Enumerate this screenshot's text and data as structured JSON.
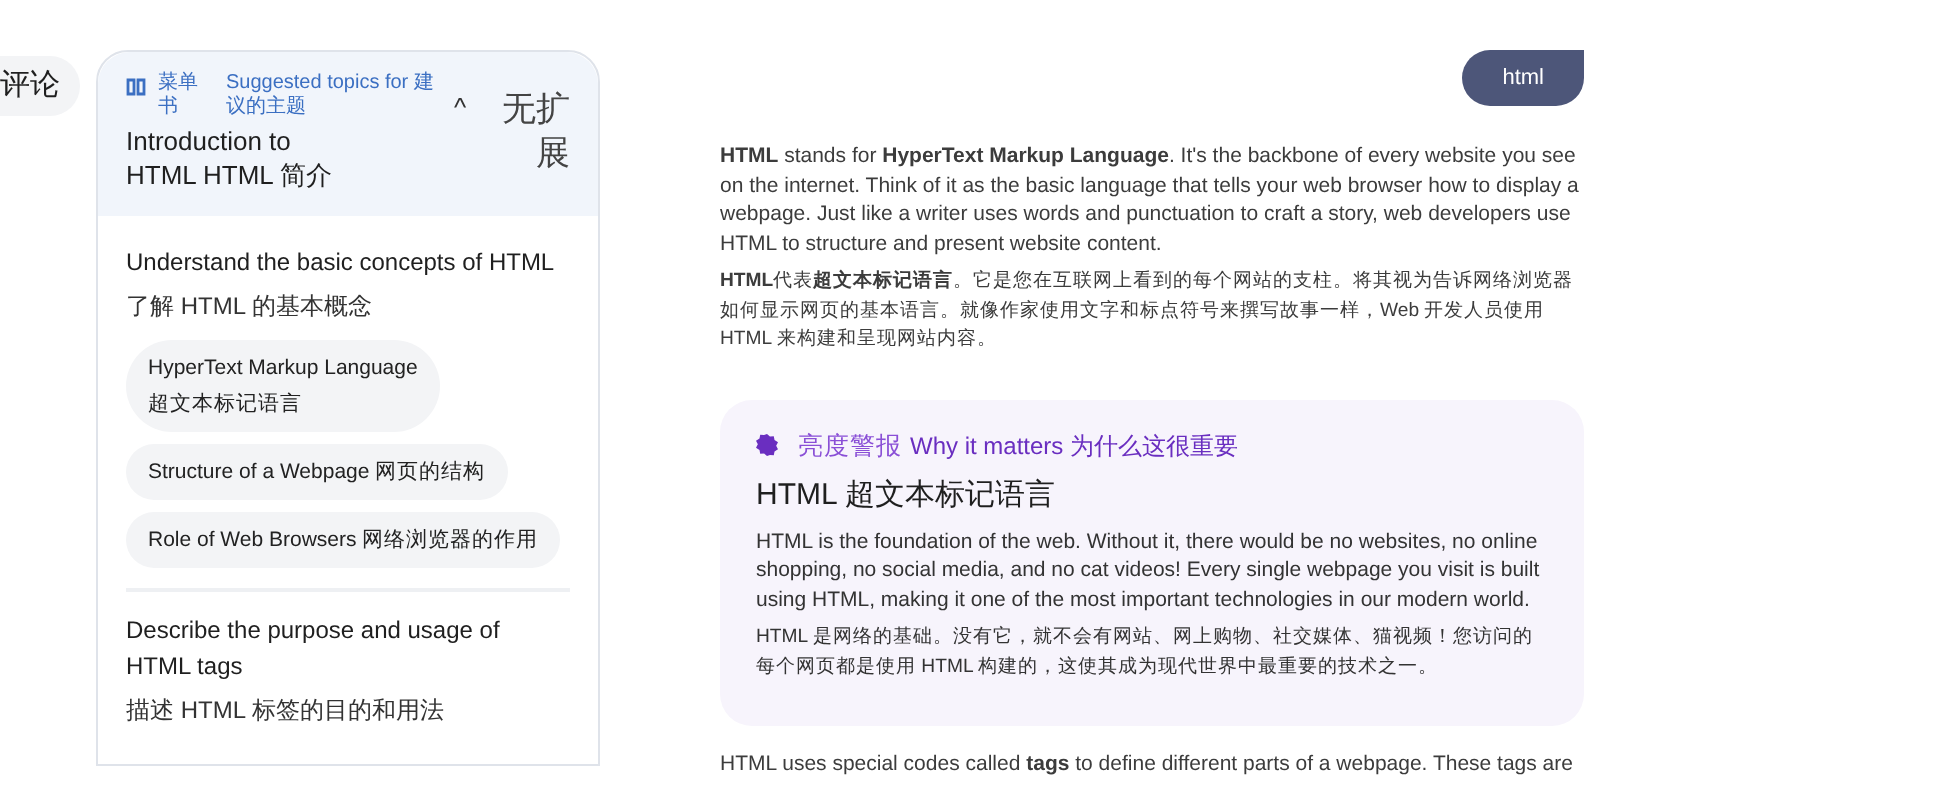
{
  "side_chip": {
    "label": "评论"
  },
  "sidebar": {
    "menu_label": "菜单书",
    "suggested_label": "Suggested topics for 建议的主题",
    "collapse_glyph": "^",
    "expand_label": "无扩展",
    "title": "Introduction to HTML HTML 简介",
    "sections": [
      {
        "title": "Understand the basic concepts of HTML",
        "subtitle": "了解 HTML 的基本概念",
        "topics": [
          {
            "label": "HyperText Markup Language",
            "sublabel": "超文本标记语言"
          },
          {
            "label": "Structure of a Webpage 网页的结构"
          },
          {
            "label": "Role of Web Browsers 网络浏览器的作用"
          }
        ]
      },
      {
        "title": "Describe the purpose and usage of HTML tags",
        "subtitle": "描述 HTML 标签的目的和用法"
      }
    ]
  },
  "chat": {
    "user_message": "html",
    "paragraphs": [
      "**HTML** stands for **HyperText Markup Language**. It's the backbone of every website you see on the internet. Think of it as the basic language that tells your web browser how to display a webpage. Just like a writer uses words and punctuation to craft a story, web developers use HTML to structure and present website content.",
      "**HTML**代表**超文本标记语言**。它是您在互联网上看到的每个网站的支柱。将其视为告诉网络浏览器如何显示网页的基本语言。就像作家使用文字和标点符号来撰写故事一样，Web 开发人员使用 HTML 来构建和呈现网站内容。"
    ],
    "callout": {
      "alert_label": "亮度警报",
      "heading": "Why it matters 为什么这很重要",
      "title": "HTML 超文本标记语言",
      "paragraphs": [
        "HTML is the foundation of the web. Without it, there would be no websites, no online shopping, no social media, and no cat videos! Every single webpage you visit is built using HTML, making it one of the most important technologies in our modern world.",
        "HTML 是网络的基础。没有它，就不会有网站、网上购物、社交媒体、猫视频！您访问的每个网页都是使用 HTML 构建的，这使其成为现代世界中最重要的技术之一。"
      ]
    },
    "trailing_paragraph": "HTML uses special codes called **tags** to define different parts of a webpage. These tags are"
  }
}
